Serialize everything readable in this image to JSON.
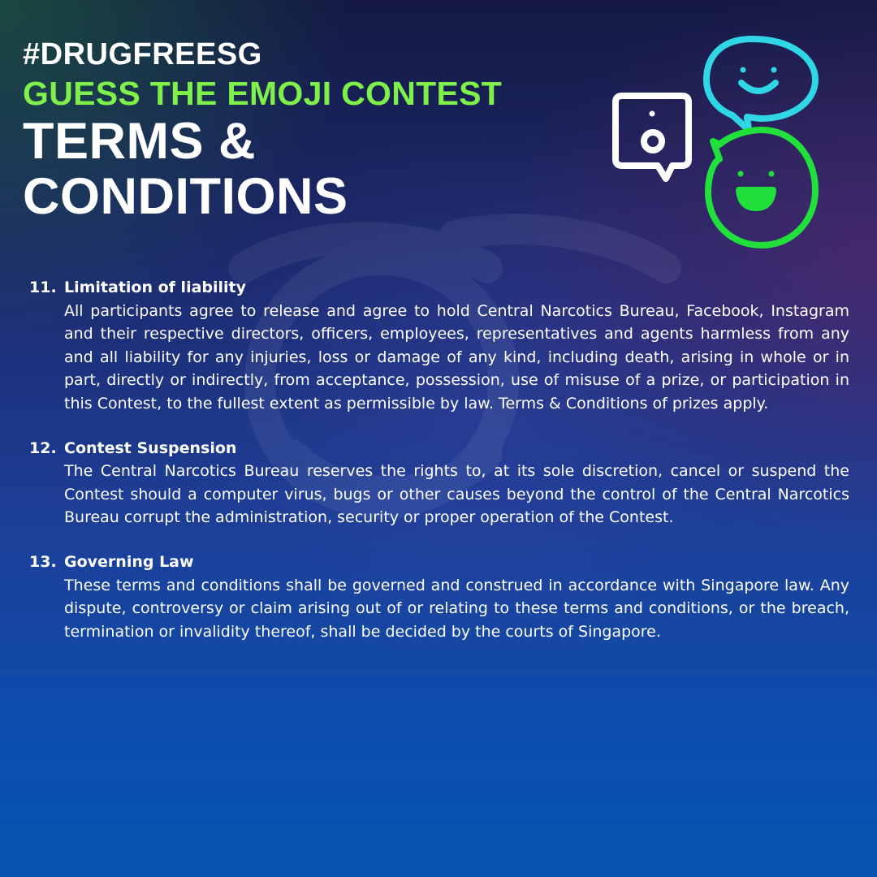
{
  "header": {
    "hashtag": "#DRUGFREESG",
    "contest_title": "GUESS THE EMOJI CONTEST",
    "page_title": "TERMS & CONDITIONS"
  },
  "colors": {
    "accent_green": "#7ff04a",
    "emoji_cyan": "#2fd6e6",
    "emoji_green": "#22e03c",
    "emoji_white": "#ffffff"
  },
  "icons": [
    "surprised-square-emoji-icon",
    "smiling-speech-bubble-icon",
    "laughing-circle-emoji-icon"
  ],
  "terms": [
    {
      "number": "11.",
      "heading": "Limitation of liability",
      "text": "All participants agree to release and agree to hold Central Narcotics Bureau, Facebook, Instagram and their respective directors, officers, employees, representatives and agents harmless from any and all liability for any injuries, loss or damage of any kind, including death, arising in whole or in part, directly or indirectly, from acceptance, possession, use of misuse of a prize, or participation in this Contest, to the fullest extent as permissible by law. Terms & Conditions of prizes apply."
    },
    {
      "number": "12.",
      "heading": "Contest Suspension",
      "text": "The Central Narcotics Bureau reserves the rights to, at its sole discretion, cancel or suspend the Contest should a computer virus, bugs or other causes beyond the control of the Central Narcotics Bureau corrupt the administration, security or proper operation of the Contest."
    },
    {
      "number": "13.",
      "heading": "Governing Law",
      "text": "These terms and conditions shall be governed and construed in accordance with Singapore law. Any dispute, controversy or claim arising out of or relating to these terms and conditions, or the breach, termination or invalidity thereof, shall be decided by the courts of Singapore."
    }
  ]
}
